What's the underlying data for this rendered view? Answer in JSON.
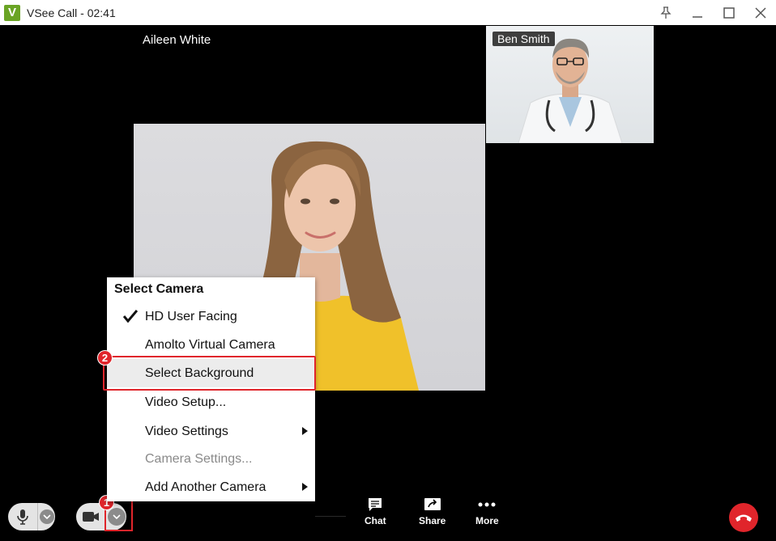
{
  "window": {
    "title": "VSee Call - 02:41",
    "logo_letter": "V"
  },
  "participants": {
    "main": {
      "name": "Aileen White"
    },
    "thumbnail": {
      "name": "Ben Smith"
    }
  },
  "camera_menu": {
    "header": "Select Camera",
    "items": [
      {
        "label": "HD User Facing"
      },
      {
        "label": "Amolto Virtual Camera"
      },
      {
        "label": "Select Background"
      },
      {
        "label": "Video Setup..."
      },
      {
        "label": "Video Settings"
      },
      {
        "label": "Camera Settings..."
      },
      {
        "label": "Add Another Camera"
      }
    ]
  },
  "annotations": {
    "step1": "1",
    "step2": "2"
  },
  "toolbar": {
    "chat_label": "Chat",
    "share_label": "Share",
    "more_label": "More"
  },
  "colors": {
    "accent_red": "#e0252b",
    "brand_green": "#6aa424"
  }
}
